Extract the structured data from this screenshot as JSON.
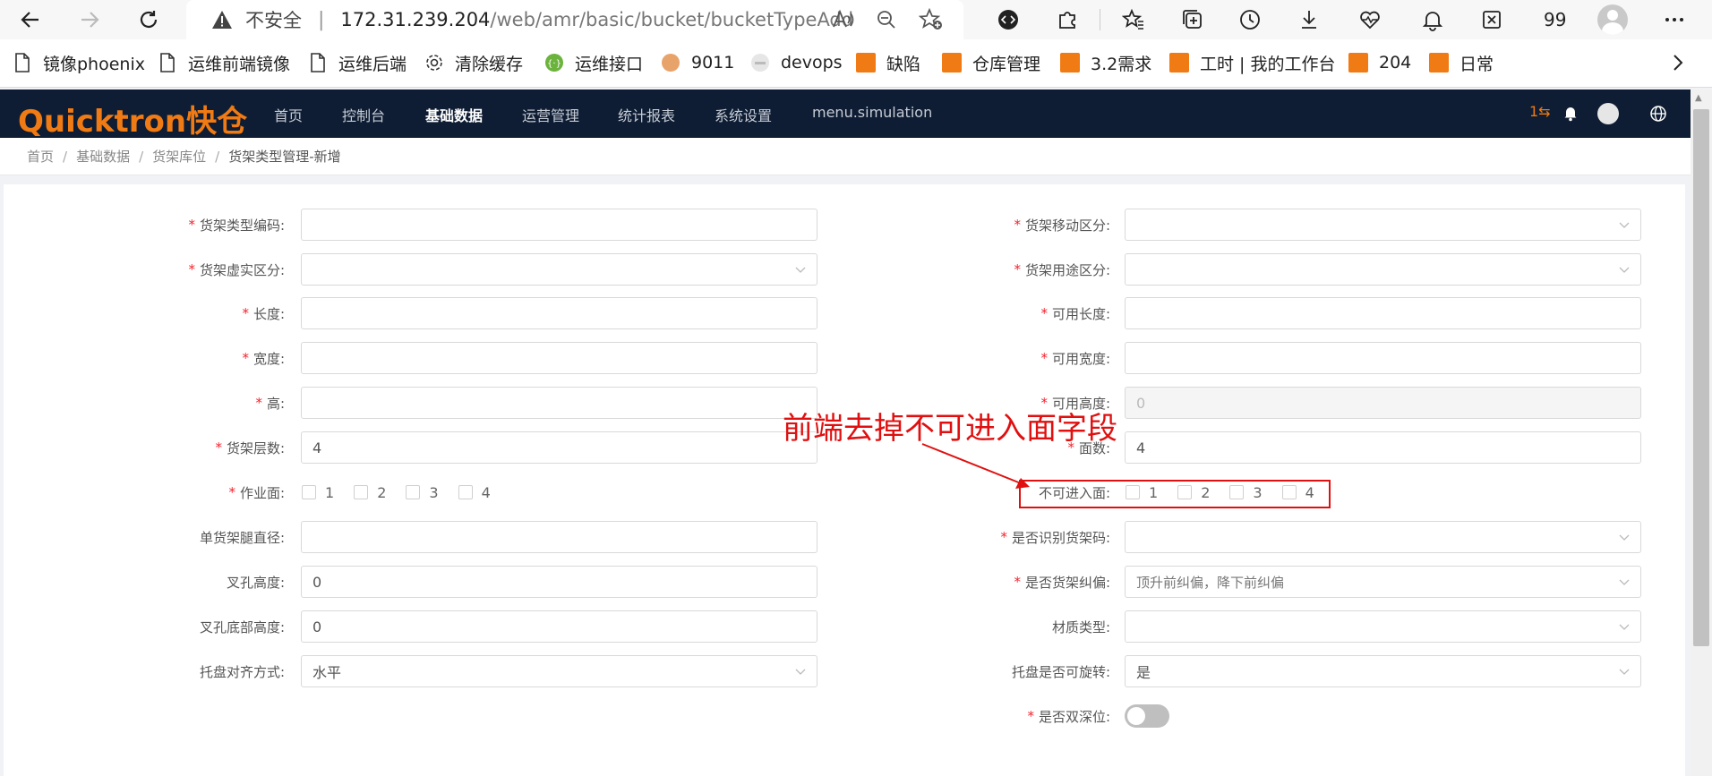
{
  "browser": {
    "address": {
      "insecure_label": "不安全",
      "separator": "|",
      "host": "172.31.239.204",
      "path": "/web/amr/basic/bucket/bucketTypeAdd"
    },
    "counter": "99",
    "bookmarks": [
      {
        "label": "镜像phoenix",
        "icon": "file-icon"
      },
      {
        "label": "运维前端镜像",
        "icon": "file-icon"
      },
      {
        "label": "运维后端",
        "icon": "file-icon"
      },
      {
        "label": "清除缓存",
        "icon": "gear-icon"
      },
      {
        "label": "运维接口",
        "icon": "api-icon"
      },
      {
        "label": "9011",
        "icon": "site-icon"
      },
      {
        "label": "devops",
        "icon": "site-icon"
      },
      {
        "label": "缺陷",
        "icon": "quicktron-logo"
      },
      {
        "label": "仓库管理",
        "icon": "quicktron-logo"
      },
      {
        "label": "3.2需求",
        "icon": "quicktron-logo"
      },
      {
        "label": "工时 | 我的工作台",
        "icon": "quicktron-logo"
      },
      {
        "label": "204",
        "icon": "quicktron-logo"
      },
      {
        "label": "日常",
        "icon": "quicktron-logo"
      }
    ]
  },
  "app": {
    "logo": "Quicktron快仓",
    "menu": [
      {
        "label": "首页",
        "active": false
      },
      {
        "label": "控制台",
        "active": false
      },
      {
        "label": "基础数据",
        "active": true
      },
      {
        "label": "运营管理",
        "active": false
      },
      {
        "label": "统计报表",
        "active": false
      },
      {
        "label": "系统设置",
        "active": false
      },
      {
        "label": "menu.simulation",
        "active": false
      }
    ],
    "header_badge": "1⇆",
    "accent_color": "#f07a13",
    "header_bg": "#0e1d33"
  },
  "breadcrumb": [
    "首页",
    "基础数据",
    "货架库位",
    "货架类型管理-新增"
  ],
  "form": {
    "left": [
      {
        "label": "货架类型编码:",
        "required": true,
        "type": "input",
        "value": ""
      },
      {
        "label": "货架虚实区分:",
        "required": true,
        "type": "select",
        "value": ""
      },
      {
        "label": "长度:",
        "required": true,
        "type": "input",
        "value": ""
      },
      {
        "label": "宽度:",
        "required": true,
        "type": "input",
        "value": ""
      },
      {
        "label": "高:",
        "required": true,
        "type": "input",
        "value": ""
      },
      {
        "label": "货架层数:",
        "required": true,
        "type": "input",
        "value": "4"
      },
      {
        "label": "作业面:",
        "required": true,
        "type": "checkbox",
        "options": [
          "1",
          "2",
          "3",
          "4"
        ]
      },
      {
        "label": "单货架腿直径:",
        "required": false,
        "type": "input",
        "value": ""
      },
      {
        "label": "叉孔高度:",
        "required": false,
        "type": "input",
        "value": "0"
      },
      {
        "label": "叉孔底部高度:",
        "required": false,
        "type": "input",
        "value": "0"
      },
      {
        "label": "托盘对齐方式:",
        "required": false,
        "type": "select",
        "value": "水平"
      }
    ],
    "right": [
      {
        "label": "货架移动区分:",
        "required": true,
        "type": "select",
        "value": ""
      },
      {
        "label": "货架用途区分:",
        "required": true,
        "type": "select",
        "value": ""
      },
      {
        "label": "可用长度:",
        "required": true,
        "type": "input",
        "value": ""
      },
      {
        "label": "可用宽度:",
        "required": true,
        "type": "input",
        "value": ""
      },
      {
        "label": "可用高度:",
        "required": true,
        "type": "disabled",
        "value": "0"
      },
      {
        "label": "面数:",
        "required": true,
        "type": "input",
        "value": "4"
      },
      {
        "label": "不可进入面:",
        "required": false,
        "type": "checkbox",
        "options": [
          "1",
          "2",
          "3",
          "4"
        ]
      },
      {
        "label": "是否识别货架码:",
        "required": true,
        "type": "select",
        "value": ""
      },
      {
        "label": "是否货架纠偏:",
        "required": true,
        "type": "select",
        "value": "顶升前纠偏，降下前纠偏"
      },
      {
        "label": "材质类型:",
        "required": false,
        "type": "select",
        "value": ""
      },
      {
        "label": "托盘是否可旋转:",
        "required": false,
        "type": "select",
        "value": "是"
      },
      {
        "label": "是否双深位:",
        "required": true,
        "type": "toggle",
        "value": false
      }
    ]
  },
  "annotation": {
    "text": "前端去掉不可进入面字段",
    "color": "#e01010"
  }
}
